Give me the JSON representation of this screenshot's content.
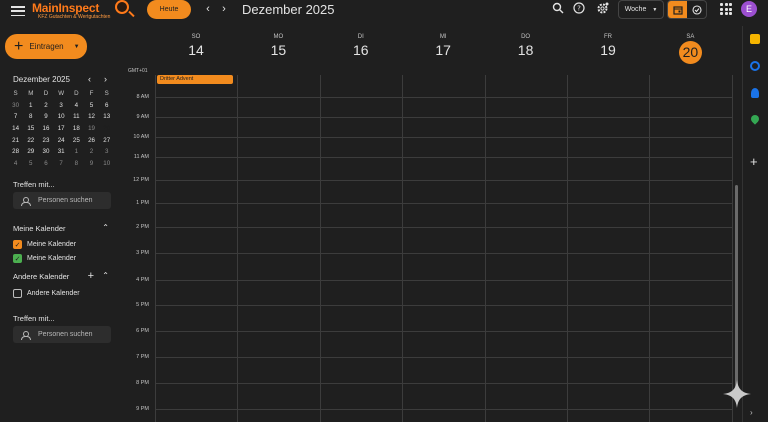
{
  "header": {
    "logo_main": "MainInspect",
    "logo_sub": "KFZ Gutachten & Wertgutachten",
    "today_label": "Heute",
    "month_title": "Dezember 2025",
    "view_label": "Woche",
    "avatar_letter": "E"
  },
  "sidebar": {
    "create_label": "Eintragen",
    "mini_calendar": {
      "title": "Dezember 2025",
      "weekdays": [
        "S",
        "M",
        "D",
        "W",
        "D",
        "F",
        "S"
      ],
      "weeks": [
        [
          {
            "d": "30",
            "o": true
          },
          {
            "d": "1"
          },
          {
            "d": "2"
          },
          {
            "d": "3"
          },
          {
            "d": "4"
          },
          {
            "d": "5"
          },
          {
            "d": "6"
          }
        ],
        [
          {
            "d": "7"
          },
          {
            "d": "8"
          },
          {
            "d": "9"
          },
          {
            "d": "10"
          },
          {
            "d": "11"
          },
          {
            "d": "12"
          },
          {
            "d": "13"
          }
        ],
        [
          {
            "d": "14"
          },
          {
            "d": "15"
          },
          {
            "d": "16"
          },
          {
            "d": "17"
          },
          {
            "d": "18"
          },
          {
            "d": "19",
            "o": true
          },
          {
            "d": "20",
            "t": true
          }
        ],
        [
          {
            "d": "21"
          },
          {
            "d": "22"
          },
          {
            "d": "23"
          },
          {
            "d": "24"
          },
          {
            "d": "25"
          },
          {
            "d": "26"
          },
          {
            "d": "27"
          }
        ],
        [
          {
            "d": "28"
          },
          {
            "d": "29"
          },
          {
            "d": "30"
          },
          {
            "d": "31"
          },
          {
            "d": "1",
            "o": true
          },
          {
            "d": "2",
            "o": true
          },
          {
            "d": "3",
            "o": true
          }
        ],
        [
          {
            "d": "4",
            "o": true
          },
          {
            "d": "5",
            "o": true
          },
          {
            "d": "6",
            "o": true
          },
          {
            "d": "7",
            "o": true
          },
          {
            "d": "8",
            "o": true
          },
          {
            "d": "9",
            "o": true
          },
          {
            "d": "10",
            "o": true
          }
        ]
      ]
    },
    "meet_label_1": "Treffen mit...",
    "search_people_1": "Personen suchen",
    "my_calendars_title": "Meine Kalender",
    "my_calendars": [
      {
        "label": "Meine Kalender",
        "color": "#f28b1e"
      },
      {
        "label": "Meine Kalender",
        "color": "#4caf50"
      }
    ],
    "other_calendars_title": "Andere Kalender",
    "other_calendar_item": "Andere Kalender",
    "meet_label_2": "Treffen mit...",
    "search_people_2": "Personen suchen"
  },
  "week": {
    "timezone": "GMT+01",
    "days": [
      {
        "dow": "SO",
        "num": "14"
      },
      {
        "dow": "MO",
        "num": "15"
      },
      {
        "dow": "DI",
        "num": "16"
      },
      {
        "dow": "MI",
        "num": "17"
      },
      {
        "dow": "DO",
        "num": "18"
      },
      {
        "dow": "FR",
        "num": "19"
      },
      {
        "dow": "SA",
        "num": "20",
        "today": true
      }
    ],
    "hours": [
      "8 AM",
      "9 AM",
      "10 AM",
      "11 AM",
      "12 PM",
      "1 PM",
      "2 PM",
      "3 PM",
      "4 PM",
      "5 PM",
      "6 PM",
      "7 PM",
      "8 PM",
      "9 PM"
    ],
    "allday_event": "Dritter Advent"
  },
  "colors": {
    "accent": "#f28b1e",
    "background": "#1f1f1f"
  }
}
